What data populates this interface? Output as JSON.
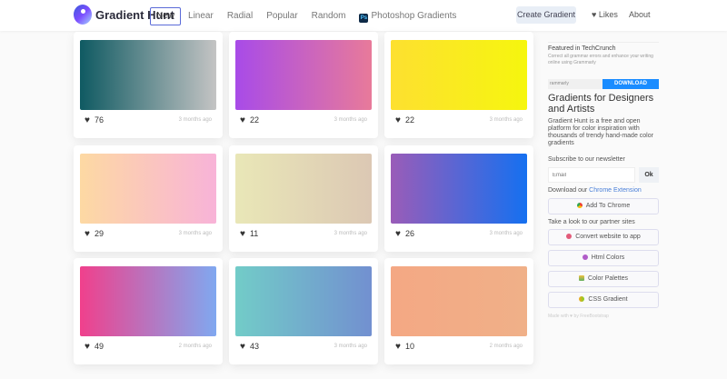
{
  "brand": {
    "name": "Gradient Hunt"
  },
  "nav": {
    "items": [
      "New",
      "Linear",
      "Radial",
      "Popular",
      "Random"
    ],
    "photoshop": "Photoshop Gradients",
    "ps_glyph": "Ps"
  },
  "header": {
    "create": "Create Gradient",
    "likes": "Likes",
    "about": "About"
  },
  "cards": [
    {
      "likes": "76",
      "ago": "3 months ago",
      "from": "#0f5a62",
      "to": "#c4c4c4"
    },
    {
      "likes": "22",
      "ago": "3 months ago",
      "from": "#a84be8",
      "to": "#e87a9a"
    },
    {
      "likes": "22",
      "ago": "3 months ago",
      "from": "#fde030",
      "to": "#f6f60e"
    },
    {
      "likes": "29",
      "ago": "3 months ago",
      "from": "#fdd9a3",
      "to": "#f8b3d8"
    },
    {
      "likes": "11",
      "ago": "3 months ago",
      "from": "#e9e7b7",
      "to": "#dcc8b4"
    },
    {
      "likes": "26",
      "ago": "3 months ago",
      "from": "#9a5cb8",
      "to": "#1570f0"
    },
    {
      "likes": "49",
      "ago": "2 months ago",
      "from": "#f0408c",
      "to": "#80a8f0"
    },
    {
      "likes": "43",
      "ago": "3 months ago",
      "from": "#72ccc8",
      "to": "#7290d0"
    },
    {
      "likes": "10",
      "ago": "2 months ago",
      "from": "#f4a884",
      "to": "#f0b088"
    }
  ],
  "sidebar": {
    "ad_title": "Featured in TechCrunch",
    "ad_body": "Correct all grammar errors and enhance your writing online using Grammarly",
    "ad_name": "rammarly",
    "ad_button": "DOWNLOAD",
    "heading": "Gradients for Designers and Artists",
    "description": "Gradient Hunt is a free and open platform for color inspiration with thousands of trendy hand-made color gradients",
    "subscribe_label": "Subscribe to our newsletter",
    "email_placeholder": "Email",
    "ok": "Ok",
    "download_prefix": "Download our",
    "download_link": "Chrome Extension",
    "add_chrome": "Add To Chrome",
    "partners_label": "Take a look to our partner sites",
    "partners": [
      "Convert website to app",
      "Html Colors",
      "Color Palettes",
      "CSS Gradient"
    ],
    "footer": "Made with ♥ by FreeBootstrap"
  }
}
